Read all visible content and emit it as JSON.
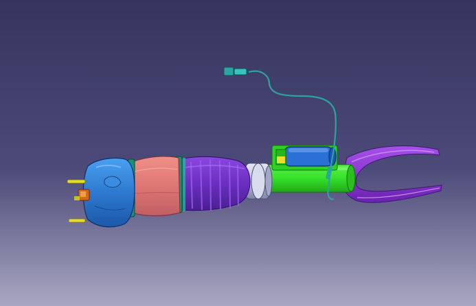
{
  "viewport": {
    "background_top_color": "#34345e",
    "background_bottom_color": "#a7a5bf"
  },
  "model": {
    "parts": [
      {
        "name": "top-mount-cap",
        "color": "#2f7fd2"
      },
      {
        "name": "air-spring-bellows",
        "color": "#e07a78"
      },
      {
        "name": "ribbed-sleeve",
        "color": "#6a2fbf"
      },
      {
        "name": "guide-tube",
        "color": "#b9c0d8"
      },
      {
        "name": "damper-body",
        "color": "#36e02a"
      },
      {
        "name": "valve-unit",
        "color": "#2b70d6"
      },
      {
        "name": "sensor-cable",
        "color": "#2aa5a1"
      },
      {
        "name": "lower-fork",
        "color": "#8a30cf"
      },
      {
        "name": "connector-pins",
        "color": "#e4dc2a"
      }
    ]
  }
}
